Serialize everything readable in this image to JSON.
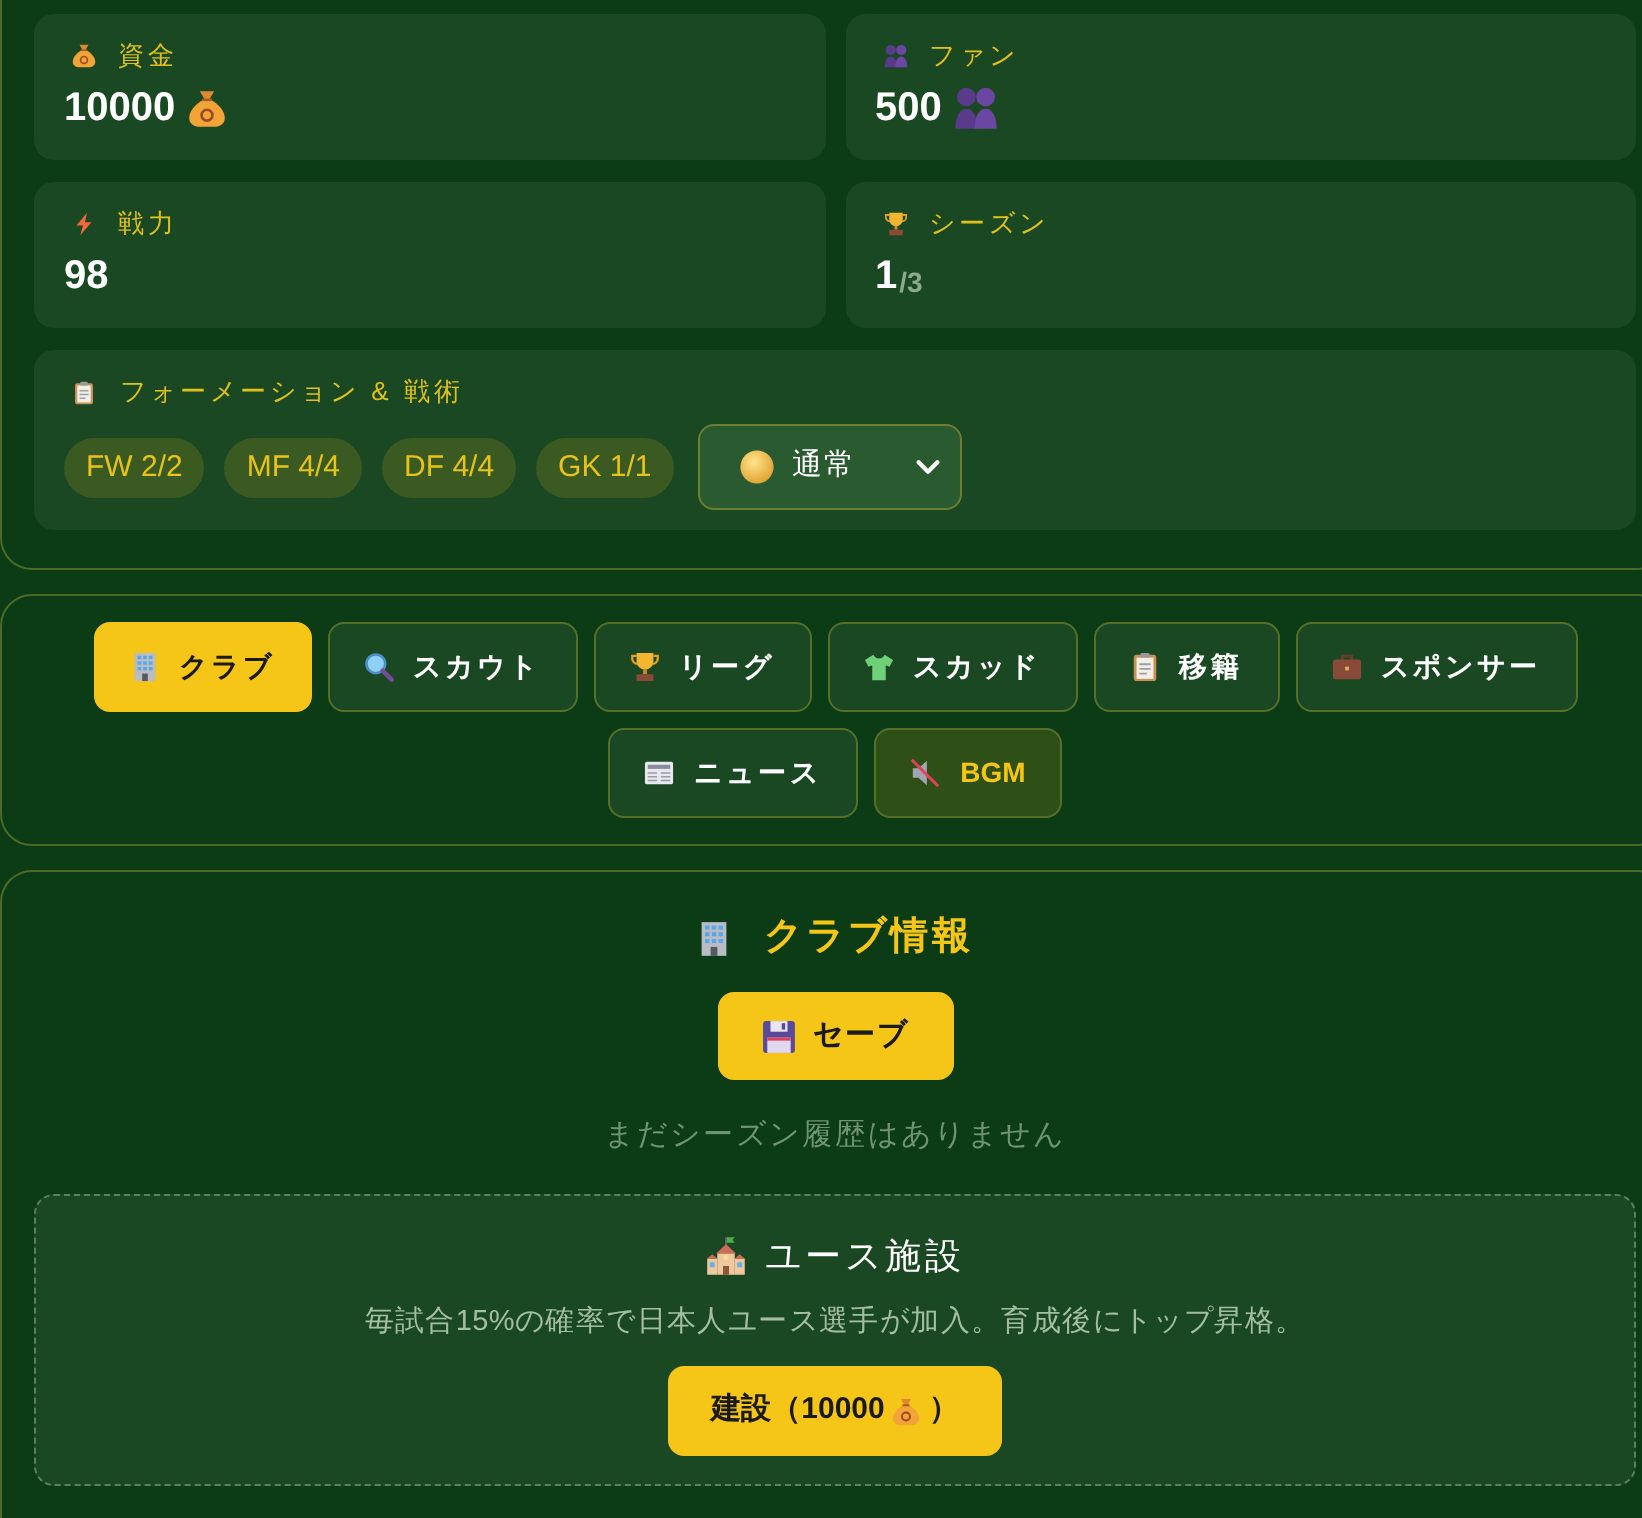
{
  "stats": [
    {
      "kind": "funds",
      "label": "資金",
      "value": "10000"
    },
    {
      "kind": "fans",
      "label": "ファン",
      "value": "500"
    },
    {
      "kind": "power",
      "label": "戦力",
      "value": "98"
    },
    {
      "kind": "season",
      "label": "シーズン",
      "value": "1",
      "suffix": "/3"
    }
  ],
  "formation": {
    "title": "フォーメーション & 戦術",
    "positions": [
      "FW 2/2",
      "MF 4/4",
      "DF 4/4",
      "GK 1/1"
    ],
    "tactic": "通常"
  },
  "nav": {
    "tabs": [
      {
        "kind": "club",
        "label": "クラブ",
        "selected": true
      },
      {
        "kind": "scout",
        "label": "スカウト",
        "selected": false
      },
      {
        "kind": "league",
        "label": "リーグ",
        "selected": false
      },
      {
        "kind": "squad",
        "label": "スカッド",
        "selected": false
      },
      {
        "kind": "transfer",
        "label": "移籍",
        "selected": false
      },
      {
        "kind": "sponsor",
        "label": "スポンサー",
        "selected": false
      },
      {
        "kind": "news",
        "label": "ニュース",
        "selected": false
      }
    ],
    "bgm": {
      "label": "BGM",
      "muted": true
    }
  },
  "club_info": {
    "title": "クラブ情報",
    "save_button": "セーブ",
    "empty_message": "まだシーズン履歴はありません",
    "youth_facility": {
      "title": "ユース施設",
      "description": "毎試合15%の確率で日本人ユース選手が加入。育成後にトップ昇格。",
      "build_button": {
        "label": "建設（10000",
        "closing": "）"
      }
    }
  }
}
